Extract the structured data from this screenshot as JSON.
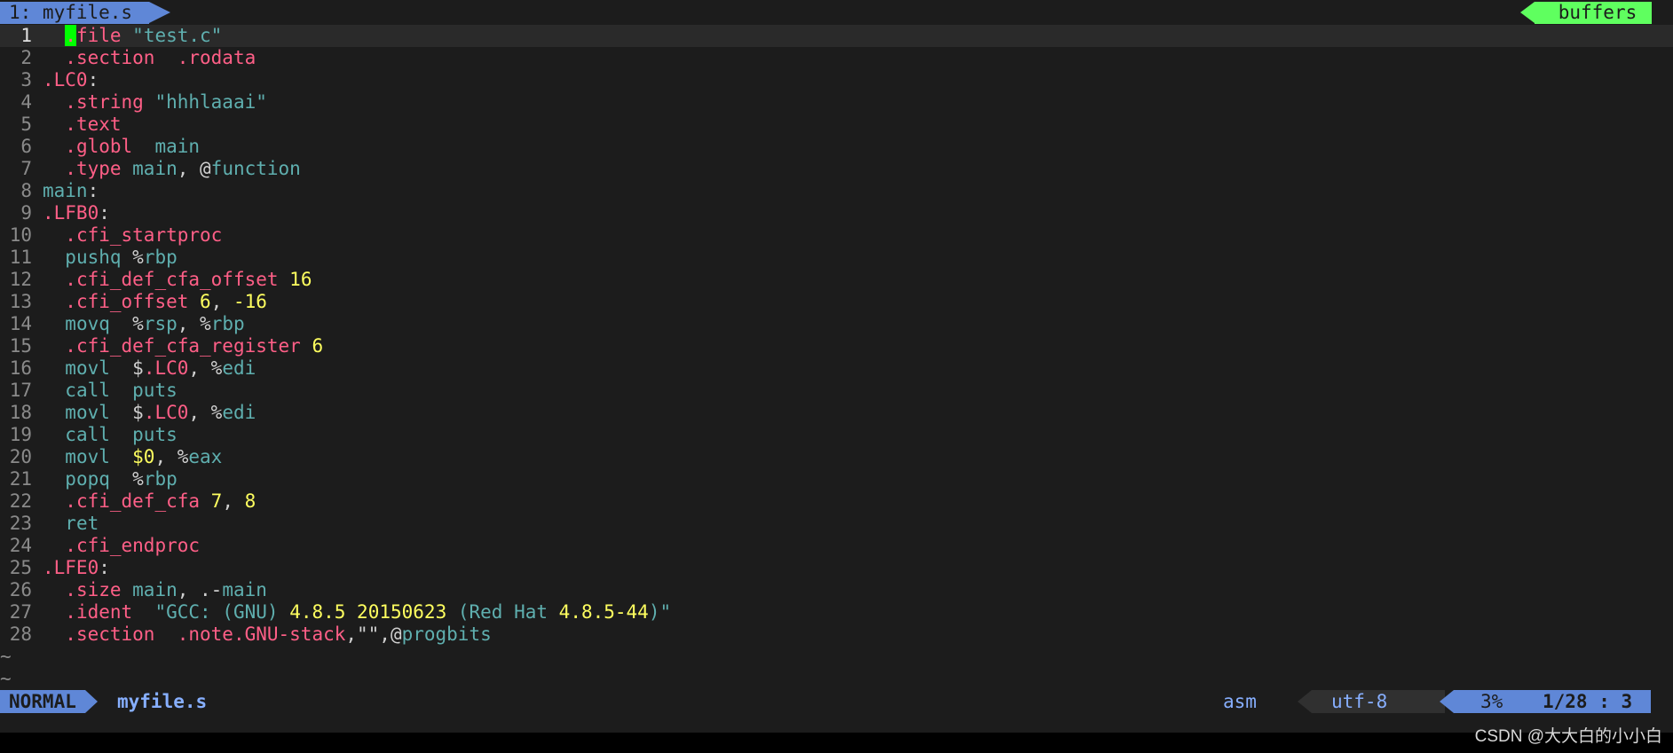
{
  "tabline": {
    "active_tab": "1: myfile.s",
    "buffers_label": "buffers"
  },
  "editor": {
    "lines": [
      [
        [
          "dir",
          "."
        ],
        [
          "dir",
          "file "
        ],
        [
          "str",
          "\"test.c\""
        ]
      ],
      [
        [
          "dir",
          ".section  .rodata"
        ]
      ],
      [
        [
          "lab",
          ".LC0"
        ],
        [
          "txt",
          ":"
        ]
      ],
      [
        [
          "dir",
          ".string "
        ],
        [
          "str",
          "\"hhhlaaai\""
        ]
      ],
      [
        [
          "dir",
          ".text"
        ]
      ],
      [
        [
          "dir",
          ".globl  "
        ],
        [
          "ins",
          "main"
        ]
      ],
      [
        [
          "dir",
          ".type "
        ],
        [
          "ins",
          "main"
        ],
        [
          "txt",
          ", @"
        ],
        [
          "ins",
          "function"
        ]
      ],
      [
        [
          "ins",
          "main"
        ],
        [
          "txt",
          ":"
        ]
      ],
      [
        [
          "lab",
          ".LFB0"
        ],
        [
          "txt",
          ":"
        ]
      ],
      [
        [
          "dir",
          ".cfi_startproc"
        ]
      ],
      [
        [
          "ins",
          "pushq "
        ],
        [
          "txt",
          "%"
        ],
        [
          "reg",
          "rbp"
        ]
      ],
      [
        [
          "dir",
          ".cfi_def_cfa_offset "
        ],
        [
          "num",
          "16"
        ]
      ],
      [
        [
          "dir",
          ".cfi_offset "
        ],
        [
          "num",
          "6"
        ],
        [
          "txt",
          ", "
        ],
        [
          "num",
          "-16"
        ]
      ],
      [
        [
          "ins",
          "movq  "
        ],
        [
          "txt",
          "%"
        ],
        [
          "reg",
          "rsp"
        ],
        [
          "txt",
          ", %"
        ],
        [
          "reg",
          "rbp"
        ]
      ],
      [
        [
          "dir",
          ".cfi_def_cfa_register "
        ],
        [
          "num",
          "6"
        ]
      ],
      [
        [
          "ins",
          "movl  "
        ],
        [
          "txt",
          "$"
        ],
        [
          "lab",
          ".LC0"
        ],
        [
          "txt",
          ", %"
        ],
        [
          "reg",
          "edi"
        ]
      ],
      [
        [
          "ins",
          "call  puts"
        ]
      ],
      [
        [
          "ins",
          "movl  "
        ],
        [
          "txt",
          "$"
        ],
        [
          "lab",
          ".LC0"
        ],
        [
          "txt",
          ", %"
        ],
        [
          "reg",
          "edi"
        ]
      ],
      [
        [
          "ins",
          "call  puts"
        ]
      ],
      [
        [
          "ins",
          "movl  "
        ],
        [
          "num",
          "$0"
        ],
        [
          "txt",
          ", %"
        ],
        [
          "reg",
          "eax"
        ]
      ],
      [
        [
          "ins",
          "popq  "
        ],
        [
          "txt",
          "%"
        ],
        [
          "reg",
          "rbp"
        ]
      ],
      [
        [
          "dir",
          ".cfi_def_cfa "
        ],
        [
          "num",
          "7"
        ],
        [
          "txt",
          ", "
        ],
        [
          "num",
          "8"
        ]
      ],
      [
        [
          "ins",
          "ret"
        ]
      ],
      [
        [
          "dir",
          ".cfi_endproc"
        ]
      ],
      [
        [
          "lab",
          ".LFE0"
        ],
        [
          "txt",
          ":"
        ]
      ],
      [
        [
          "dir",
          ".size "
        ],
        [
          "ins",
          "main"
        ],
        [
          "txt",
          ", .-"
        ],
        [
          "ins",
          "main"
        ]
      ],
      [
        [
          "dir",
          ".ident  "
        ],
        [
          "str",
          "\"GCC: ("
        ],
        [
          "ins",
          "GNU"
        ],
        [
          "str",
          ") "
        ],
        [
          "num",
          "4.8.5 20150623"
        ],
        [
          "str",
          " ("
        ],
        [
          "ins",
          "Red Hat "
        ],
        [
          "num",
          "4.8.5-44"
        ],
        [
          "str",
          ")\""
        ]
      ],
      [
        [
          "dir",
          ".section  .note.GNU-stack"
        ],
        [
          "txt",
          ",\"\",@"
        ],
        [
          "ins",
          "progbits"
        ]
      ]
    ],
    "indented": [
      true,
      true,
      false,
      true,
      true,
      true,
      true,
      false,
      false,
      true,
      true,
      true,
      true,
      true,
      true,
      true,
      true,
      true,
      true,
      true,
      true,
      true,
      true,
      true,
      false,
      true,
      true,
      true
    ],
    "tilde": "~"
  },
  "status": {
    "mode": "NORMAL",
    "filename": "myfile.s",
    "filetype": "asm",
    "encoding": "utf-8",
    "percent": "3%",
    "position": "1/28 :  3"
  },
  "watermark": "CSDN @大大白的小小白",
  "colors": {
    "directive": "#ff5f87",
    "string": "#5fafaf",
    "number": "#ffff5f",
    "label": "#ff5f87",
    "instruction": "#5fafaf",
    "accent_blue": "#5f87d7",
    "accent_green": "#5fff5f"
  }
}
